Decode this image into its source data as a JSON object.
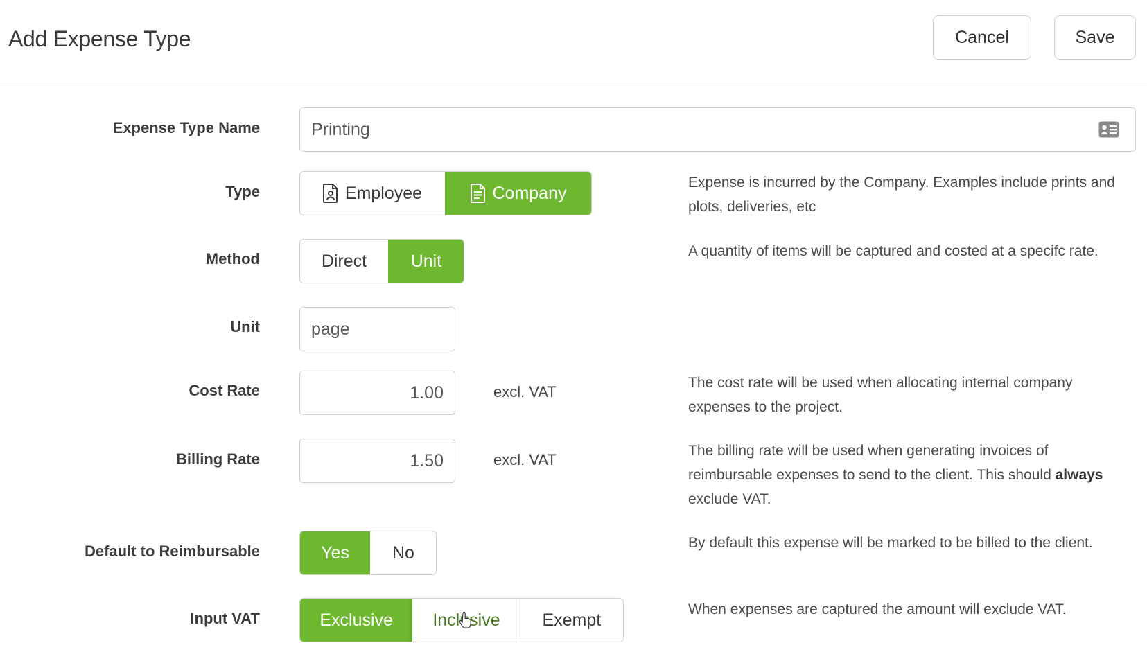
{
  "header": {
    "title": "Add Expense Type",
    "cancel_label": "Cancel",
    "save_label": "Save"
  },
  "form": {
    "name": {
      "label": "Expense Type Name",
      "value": "Printing",
      "icon": "id-card-icon"
    },
    "type": {
      "label": "Type",
      "options": [
        {
          "label": "Employee",
          "icon": "employee-document-icon",
          "selected": false
        },
        {
          "label": "Company",
          "icon": "company-document-icon",
          "selected": true
        }
      ],
      "help": "Expense is incurred by the Company. Examples include prints and plots, deliveries, etc"
    },
    "method": {
      "label": "Method",
      "options": [
        {
          "label": "Direct",
          "selected": false
        },
        {
          "label": "Unit",
          "selected": true
        }
      ],
      "help": "A quantity of items will be captured and costed at a specifc rate."
    },
    "unit": {
      "label": "Unit",
      "value": "page"
    },
    "cost_rate": {
      "label": "Cost Rate",
      "value": "1.00",
      "suffix": "excl. VAT",
      "help": "The cost rate will be used when allocating internal company expenses to the project."
    },
    "billing_rate": {
      "label": "Billing Rate",
      "value": "1.50",
      "suffix": "excl. VAT",
      "help_before": "The billing rate will be used when generating invoices of reimbursable expenses to send to the client. This should ",
      "help_bold": "always",
      "help_after": " exclude VAT."
    },
    "reimbursable": {
      "label": "Default to Reimbursable",
      "options": [
        {
          "label": "Yes",
          "selected": true
        },
        {
          "label": "No",
          "selected": false
        }
      ],
      "help": "By default this expense will be marked to be billed to the client."
    },
    "input_vat": {
      "label": "Input VAT",
      "options": [
        {
          "label": "Exclusive",
          "selected": true
        },
        {
          "label": "Inclusive",
          "selected": false,
          "hover": true
        },
        {
          "label": "Exempt",
          "selected": false
        }
      ],
      "help": "When expenses are captured the amount will exclude VAT."
    }
  },
  "colors": {
    "accent": "#6db82f",
    "border": "#cfcfcf"
  }
}
